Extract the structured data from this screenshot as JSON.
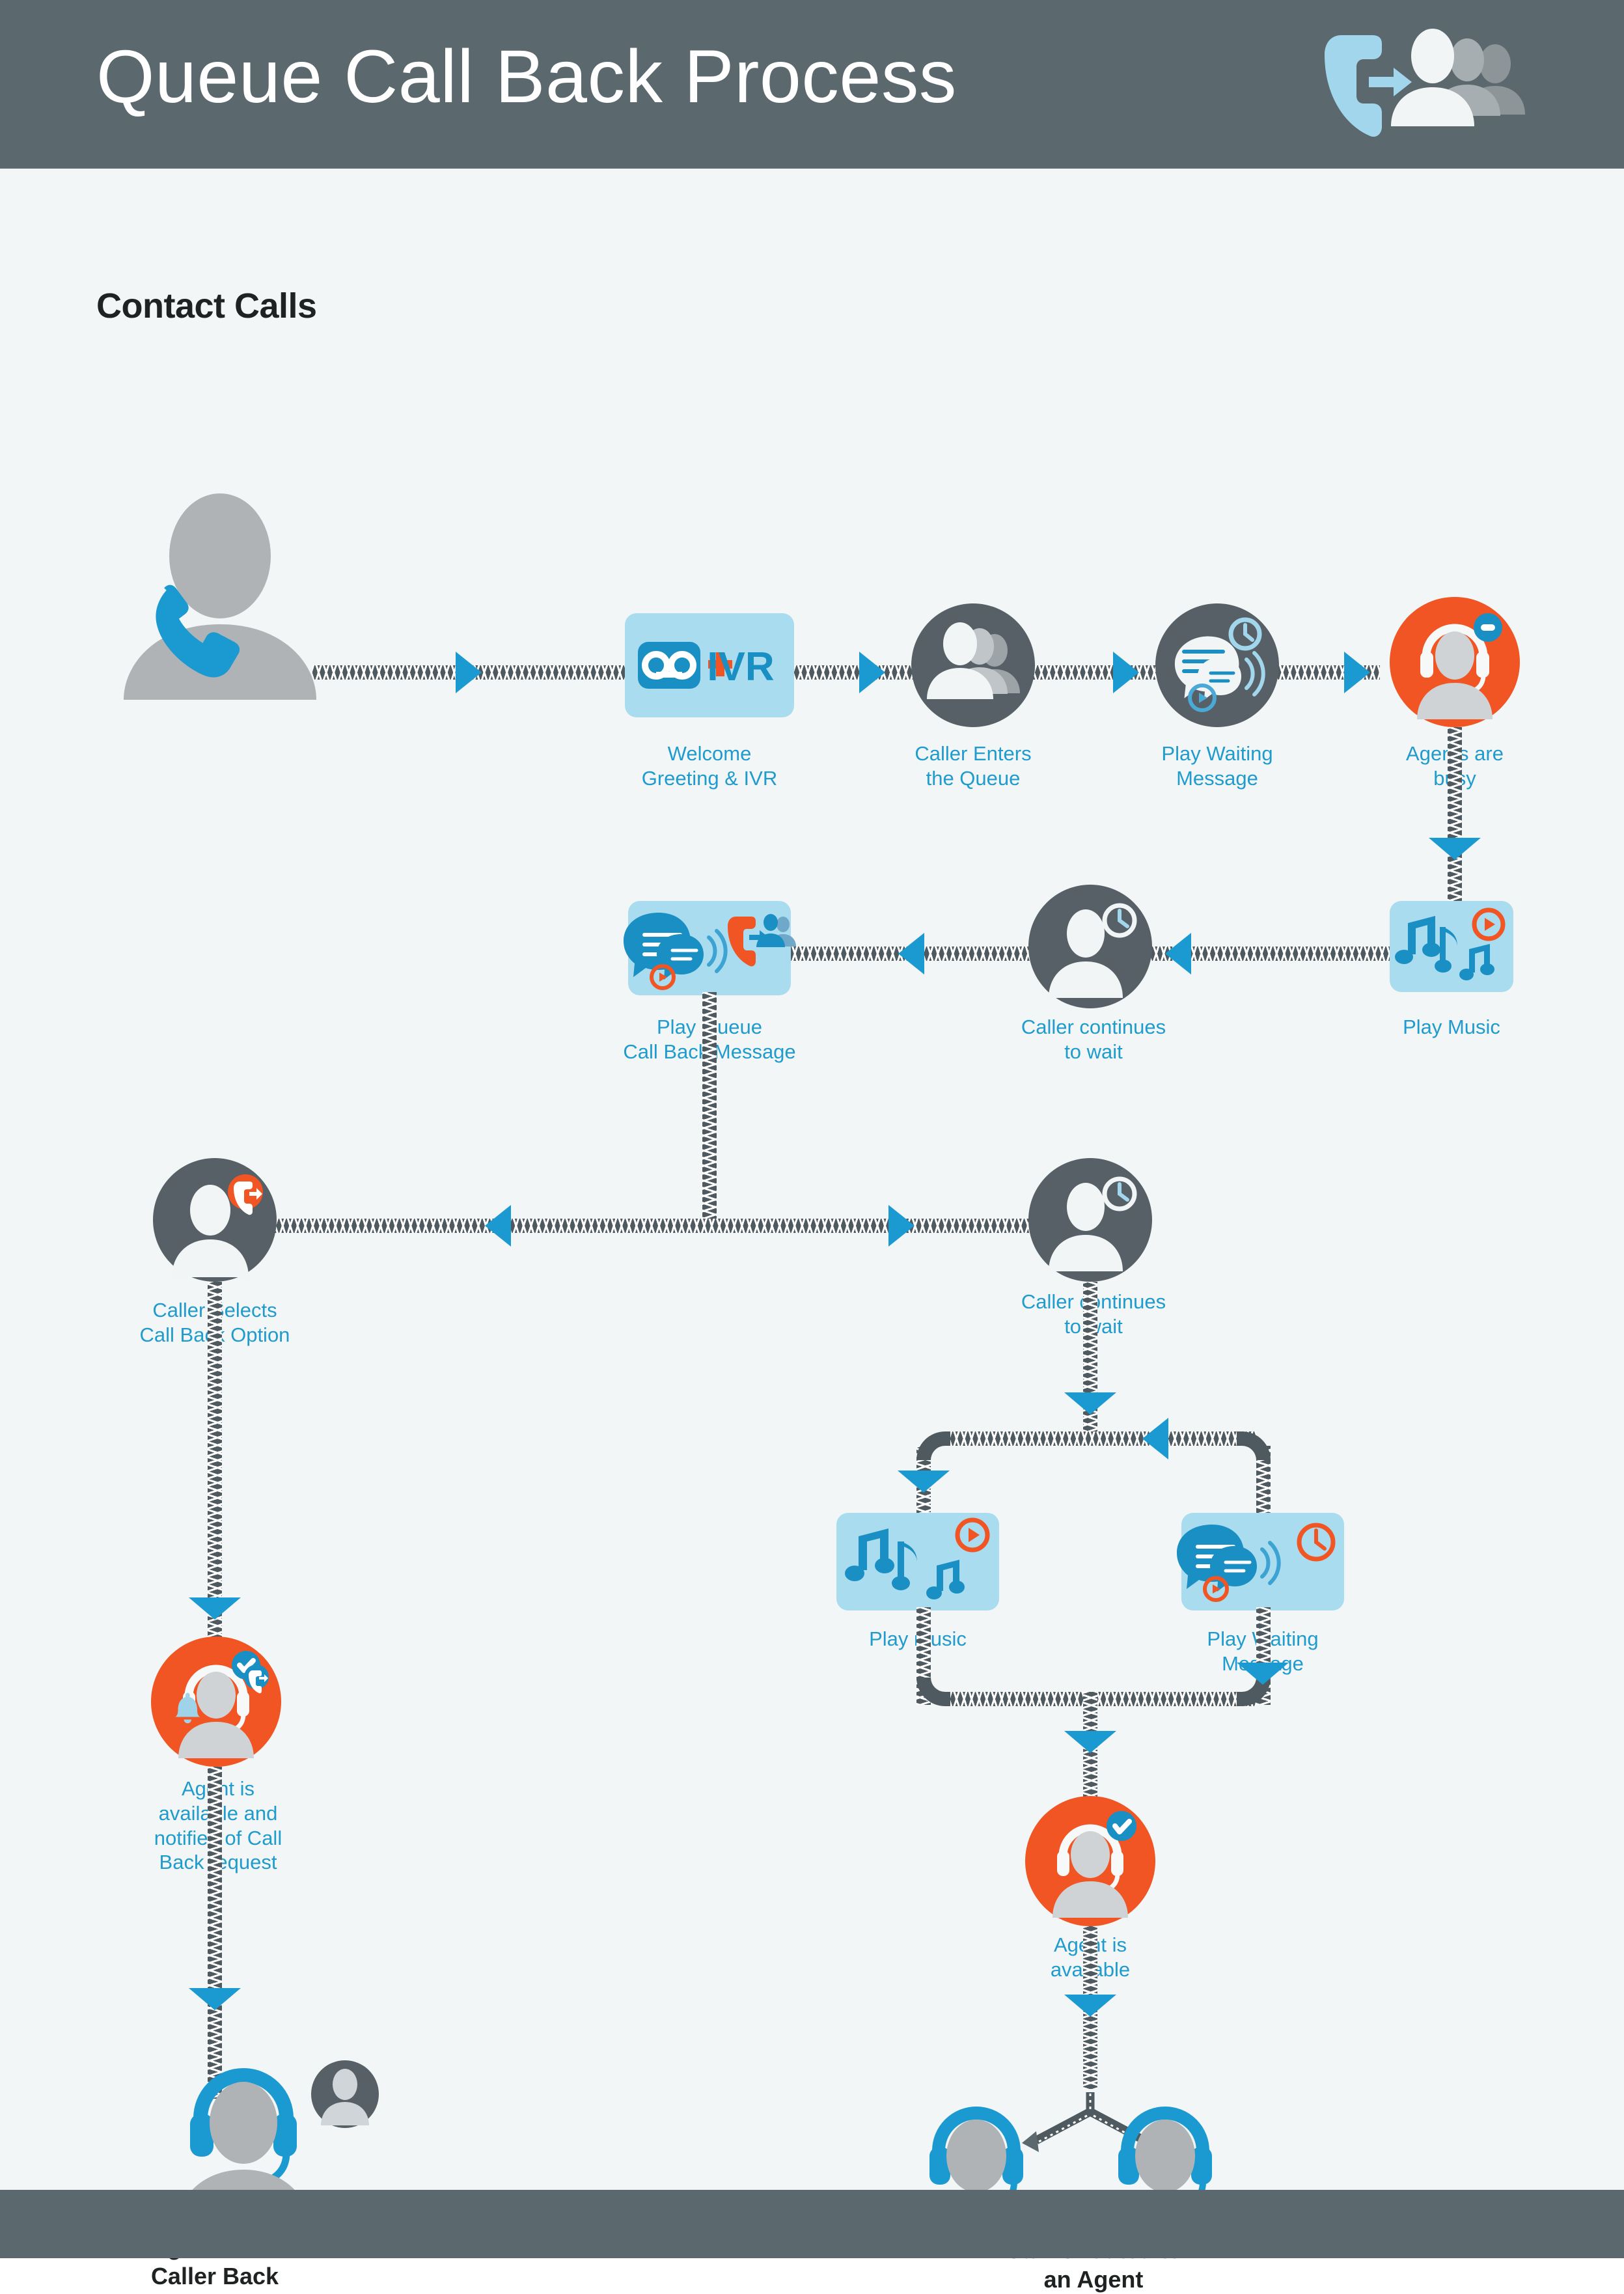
{
  "header": {
    "title": "Queue Call Back Process",
    "icon": "phone-to-people-icon",
    "bg_color": "#5b686e"
  },
  "colors": {
    "background": "#f3f6f6",
    "header_bar": "#5b686e",
    "node_dark": "#566066",
    "node_orange": "#f05523",
    "node_lightblue": "#a9dcef",
    "accent_blue": "#1b9ad2",
    "caption_blue": "#1f9bcd",
    "cord": "#4e5a60",
    "silhouette_gray": "#b0b3b5",
    "text_dark": "#1f2223"
  },
  "section": {
    "title": "Contact Calls"
  },
  "nodes": {
    "contact_caller": {
      "label": "",
      "icon": "person-with-phone-icon"
    },
    "welcome_ivr": {
      "label": "Welcome\nGreeting & IVR",
      "icon": "voicemail-plus-ivr-icon",
      "shape": "box"
    },
    "caller_enters_queue": {
      "label": "Caller Enters\nthe Queue",
      "icon": "group-of-people-icon",
      "shape": "circle-dark"
    },
    "play_waiting_message_1": {
      "label": "Play Waiting\nMessage",
      "icon": "speech-bubbles-clock-play-icon",
      "shape": "circle-dark"
    },
    "agents_busy": {
      "label": "Agents are\nbusy",
      "icon": "agent-headset-minus-icon",
      "shape": "circle-orange"
    },
    "play_music_1": {
      "label": "Play Music",
      "icon": "music-notes-play-icon",
      "shape": "box"
    },
    "caller_waits_1": {
      "label": "Caller continues\nto wait",
      "icon": "person-clock-icon",
      "shape": "circle-dark"
    },
    "play_queue_callback_message": {
      "label": "Play Queue\nCall Back Message",
      "icon": "speech-bubbles-callback-play-icon",
      "shape": "box"
    },
    "caller_selects_callback": {
      "label": "Caller Selects\nCall Back Option",
      "icon": "person-phone-callback-icon",
      "shape": "circle-dark"
    },
    "caller_waits_2": {
      "label": "Caller continues\nto wait",
      "icon": "person-clock-icon",
      "shape": "circle-dark"
    },
    "play_music_2": {
      "label": "Play music",
      "icon": "music-notes-play-icon",
      "shape": "box"
    },
    "play_waiting_message_2": {
      "label": "Play Waiting\nMessage",
      "icon": "speech-bubbles-clock-play-icon",
      "shape": "box"
    },
    "agent_available_notified": {
      "label": "Agent is\navailable and\nnotified of Call\nBack request",
      "icon": "agent-headset-check-phone-bell-icon",
      "shape": "circle-orange"
    },
    "agent_available": {
      "label": "Agent is\navailable",
      "icon": "agent-headset-check-icon",
      "shape": "circle-orange"
    },
    "agent_calls_back": {
      "label": "Agent Calls\nCaller Back",
      "icon": "agent-headset-and-caller-icon"
    },
    "call_routed": {
      "label": "Call is routed to\nan Agent",
      "icon": "two-agents-headset-icon"
    }
  }
}
